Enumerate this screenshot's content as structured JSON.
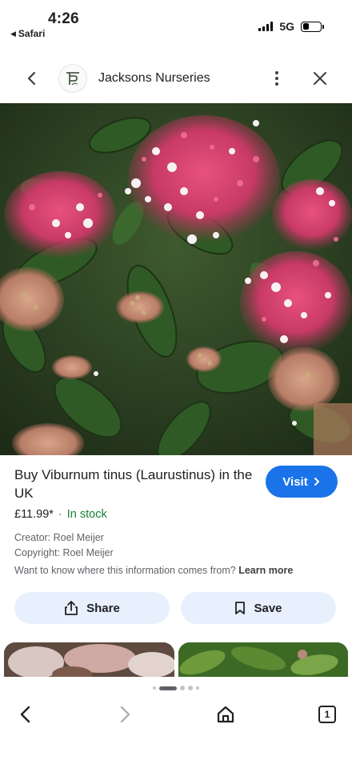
{
  "status_bar": {
    "time": "4:26",
    "back_app": "Safari",
    "network": "5G",
    "battery_level": 0.35,
    "signal_bars": 4
  },
  "header": {
    "site_name": "Jacksons Nurseries",
    "back_icon": "chevron-left-icon",
    "more_icon": "more-vert-icon",
    "close_icon": "close-icon"
  },
  "result": {
    "title": "Buy Viburnum tinus (Laurustinus) in the UK",
    "visit_label": "Visit",
    "price": "£11.99*",
    "separator": "·",
    "stock": "In stock",
    "creator": "Creator: Roel Meijer",
    "copyright": "Copyright: Roel Meijer",
    "info_question": "Want to know where this information comes from?",
    "learn_more": "Learn more",
    "share_label": "Share",
    "save_label": "Save"
  },
  "pager": {
    "pages": 5,
    "active": 1
  },
  "toolbar": {
    "tab_count": "1"
  },
  "colors": {
    "accent": "#1a73e8",
    "in_stock": "#188038",
    "action_bg": "#e8f0fe",
    "secondary_text": "#5f6368"
  }
}
